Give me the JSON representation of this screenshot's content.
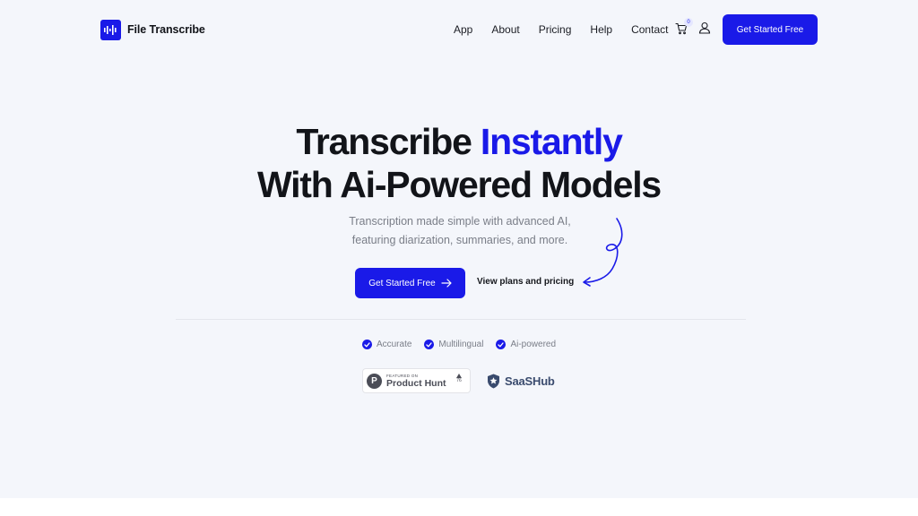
{
  "header": {
    "brand": "File Transcribe",
    "nav": [
      "App",
      "About",
      "Pricing",
      "Help",
      "Contact"
    ],
    "cart_count": "0",
    "cta_label": "Get Started Free"
  },
  "hero": {
    "title_line1_plain": "Transcribe ",
    "title_line1_accent": "Instantly",
    "title_line2": "With Ai-Powered Models",
    "subtitle_line1": "Transcription made simple with advanced AI,",
    "subtitle_line2": "featuring diarization, summaries, and more.",
    "cta_label": "Get Started Free",
    "secondary_link": "View plans and pricing"
  },
  "features": [
    "Accurate",
    "Multilingual",
    "Ai-powered"
  ],
  "badges": {
    "product_hunt": {
      "featured_on": "FEATURED ON",
      "name": "Product Hunt",
      "votes": "76"
    },
    "saashub": "SaaSHub"
  },
  "colors": {
    "accent": "#1a1ae8",
    "background": "#f4f6fb",
    "text": "#121419",
    "muted": "#7a7e88"
  },
  "icons": [
    "logo-waveform-icon",
    "cart-icon",
    "user-icon",
    "arrow-right-icon",
    "check-circle-icon",
    "product-hunt-icon",
    "saashub-shield-icon",
    "squiggle-arrow-icon"
  ]
}
